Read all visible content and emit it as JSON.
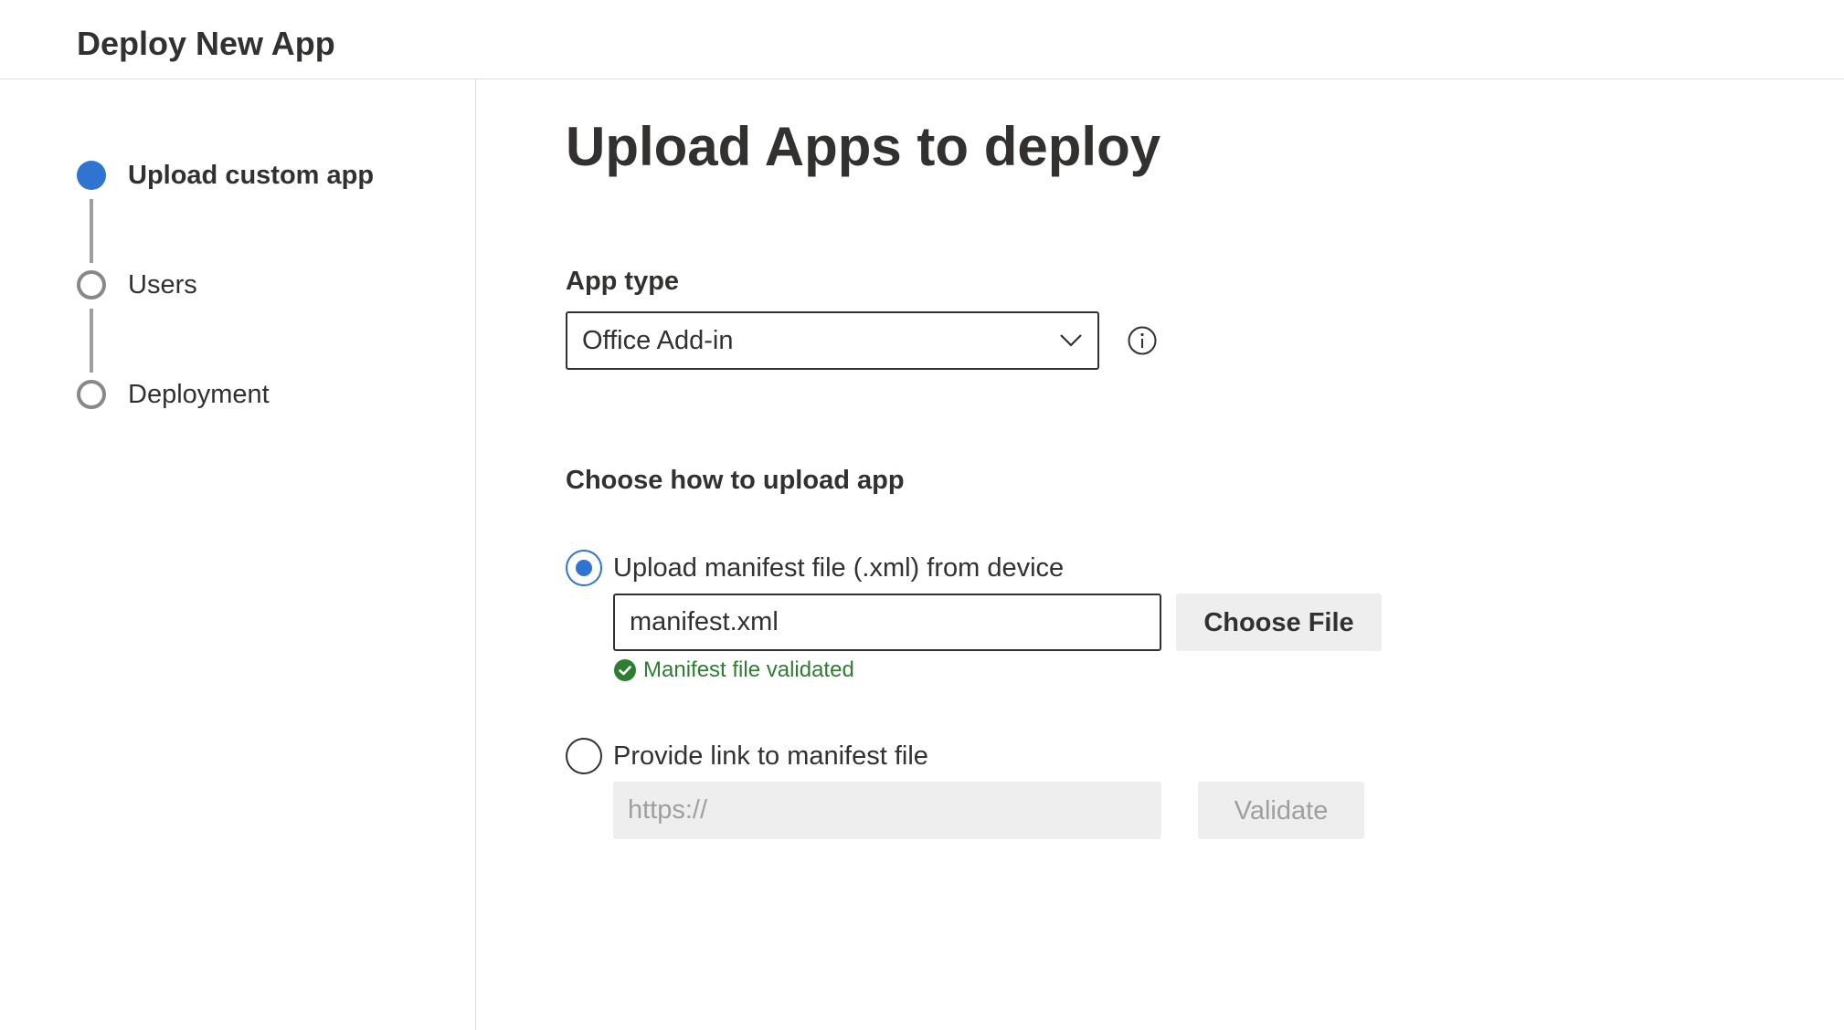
{
  "header": {
    "title": "Deploy New App"
  },
  "steps": [
    {
      "label": "Upload custom app",
      "state": "active"
    },
    {
      "label": "Users",
      "state": "inactive"
    },
    {
      "label": "Deployment",
      "state": "inactive"
    }
  ],
  "main": {
    "title": "Upload Apps to deploy",
    "app_type": {
      "label": "App type",
      "selected": "Office Add-in",
      "icon": "chevron-down-icon",
      "info_icon": "info-icon"
    },
    "upload": {
      "section_label": "Choose how to upload app",
      "option_file": {
        "label": "Upload manifest file (.xml) from device",
        "selected": true,
        "input_value": "manifest.xml",
        "button_label": "Choose File",
        "status_text": "Manifest file validated",
        "status_icon": "check-circle-icon"
      },
      "option_link": {
        "label": "Provide link to manifest file",
        "selected": false,
        "input_placeholder": "https://",
        "button_label": "Validate"
      }
    }
  },
  "colors": {
    "accent": "#2f74d0",
    "success": "#2e7d32",
    "text": "#323130",
    "disabled_bg": "#eeeeee",
    "disabled_text": "#a19f9d"
  }
}
